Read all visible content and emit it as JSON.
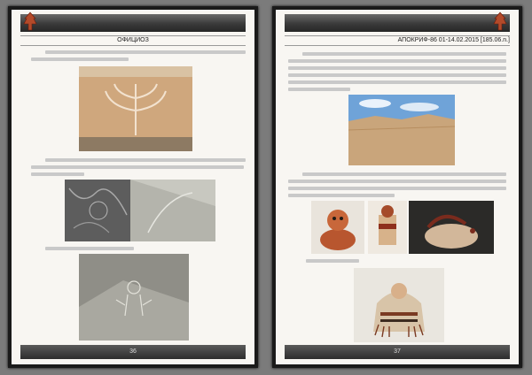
{
  "left_page": {
    "page_number": "36",
    "sub_band": "ОФИЦИОЗ"
  },
  "right_page": {
    "page_number": "37",
    "sub_band": "АПОКРИФ-86 01-14.02.2015 [185.06.n.]"
  },
  "colors": {
    "page_bg": "#f8f6f2",
    "band_dark": "#2d2d2d",
    "desert": "#c9a57b",
    "sky": "#6fa3d8"
  },
  "icons": [
    "logo-emblem-icon"
  ]
}
